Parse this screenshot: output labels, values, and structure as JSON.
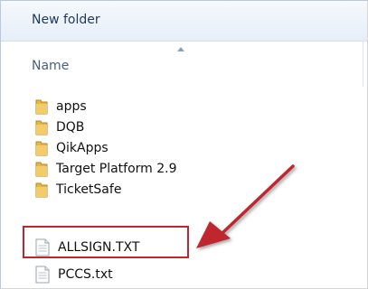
{
  "header": {
    "title": "New folder"
  },
  "columns": {
    "name_label": "Name"
  },
  "files": [
    {
      "name": "apps",
      "icon": "folder-icon",
      "type": "folder"
    },
    {
      "name": "DQB",
      "icon": "folder-icon",
      "type": "folder"
    },
    {
      "name": "QikApps",
      "icon": "folder-icon",
      "type": "folder"
    },
    {
      "name": "Target Platform 2.9",
      "icon": "folder-icon",
      "type": "folder"
    },
    {
      "name": "TicketSafe",
      "icon": "folder-icon",
      "type": "folder"
    },
    {
      "name": "ALLSIGN.TXT",
      "icon": "text-file-icon",
      "type": "file"
    },
    {
      "name": "PCCS.txt",
      "icon": "text-file-icon",
      "type": "file"
    }
  ],
  "annotation": {
    "highlight_color": "#c0262f",
    "highlighted_item": "ALLSIGN.TXT"
  }
}
